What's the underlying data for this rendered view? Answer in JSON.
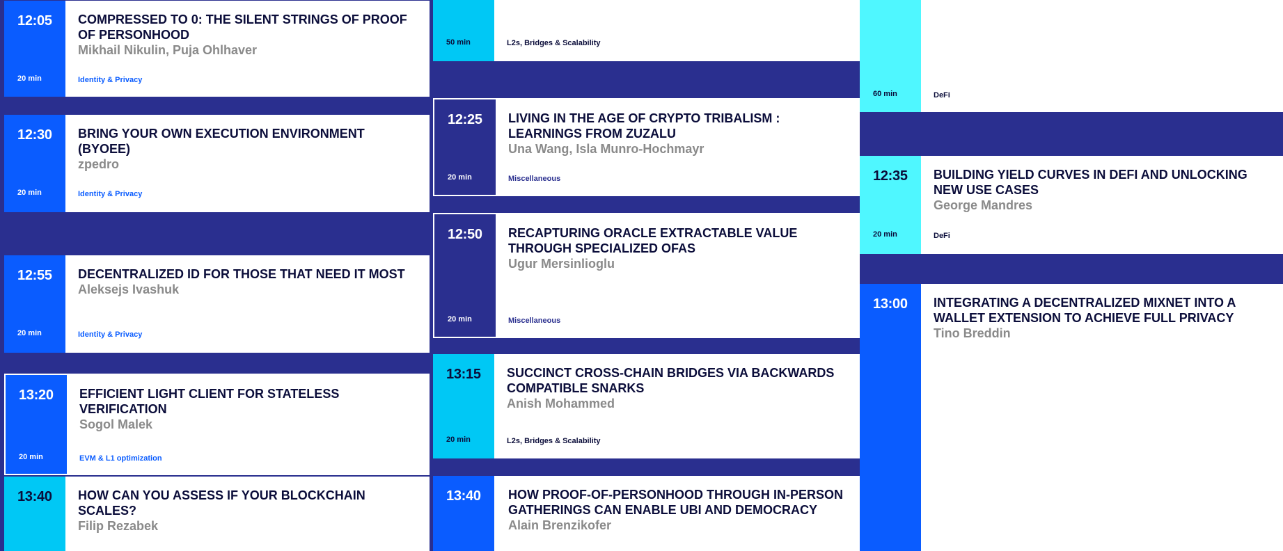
{
  "columns": [
    {
      "sessions": [
        {
          "time": "12:05",
          "title": "COMPRESSED TO 0: THE SILENT STRINGS OF PROOF OF PERSONHOOD",
          "speakers": "Mikhail Nikulin, Puja Ohlhaver",
          "duration": "20 min",
          "track": "Identity & Privacy"
        },
        {
          "time": "12:30",
          "title": "BRING YOUR OWN EXECUTION ENVIRONMENT (BYOEE)",
          "speakers": "zpedro",
          "duration": "20 min",
          "track": "Identity & Privacy"
        },
        {
          "time": "12:55",
          "title": "DECENTRALIZED ID FOR THOSE THAT NEED IT MOST",
          "speakers": "Aleksejs Ivashuk",
          "duration": "20 min",
          "track": "Identity & Privacy"
        },
        {
          "time": "13:20",
          "title": "EFFICIENT LIGHT CLIENT FOR STATELESS VERIFICATION",
          "speakers": "Sogol Malek",
          "duration": "20 min",
          "track": "EVM & L1 optimization"
        },
        {
          "time": "13:40",
          "title": "HOW CAN YOU ASSESS IF YOUR BLOCKCHAIN SCALES?",
          "speakers": "Filip Rezabek",
          "duration": "",
          "track": ""
        }
      ]
    },
    {
      "sessions": [
        {
          "time": "",
          "title": "",
          "speakers": "",
          "duration": "50 min",
          "track": "L2s, Bridges & Scalability"
        },
        {
          "time": "12:25",
          "title": "LIVING IN THE AGE OF CRYPTO TRIBALISM : LEARNINGS FROM ZUZALU",
          "speakers": "Una Wang, Isla Munro-Hochmayr",
          "duration": "20 min",
          "track": "Miscellaneous"
        },
        {
          "time": "12:50",
          "title": "RECAPTURING ORACLE EXTRACTABLE VALUE THROUGH SPECIALIZED OFAS",
          "speakers": "Ugur Mersinlioglu",
          "duration": "20 min",
          "track": "Miscellaneous"
        },
        {
          "time": "13:15",
          "title": "SUCCINCT CROSS-CHAIN BRIDGES VIA BACKWARDS COMPATIBLE SNARKS",
          "speakers": "Anish Mohammed",
          "duration": "20 min",
          "track": "L2s, Bridges & Scalability"
        },
        {
          "time": "13:40",
          "title": "HOW PROOF-OF-PERSONHOOD THROUGH IN-PERSON GATHERINGS CAN ENABLE UBI AND DEMOCRACY",
          "speakers": "Alain Brenzikofer",
          "duration": "",
          "track": ""
        }
      ]
    },
    {
      "sessions": [
        {
          "time": "",
          "title": "",
          "speakers": "",
          "duration": "60 min",
          "track": "DeFi"
        },
        {
          "time": "12:35",
          "title": "BUILDING YIELD CURVES IN DEFI AND UNLOCKING NEW USE CASES",
          "speakers": "George Mandres",
          "duration": "20 min",
          "track": "DeFi"
        },
        {
          "time": "13:00",
          "title": "INTEGRATING A DECENTRALIZED MIXNET INTO A WALLET EXTENSION TO ACHIEVE FULL PRIVACY",
          "speakers": "Tino Breddin",
          "duration": "",
          "track": ""
        }
      ]
    }
  ],
  "colors": {
    "identity_privacy": "#0a5cff",
    "miscellaneous": "#2a2f8f",
    "l2s_bridges": "#00c8f5",
    "defi": "#4ff7ff",
    "background": "#2a2f8f"
  }
}
